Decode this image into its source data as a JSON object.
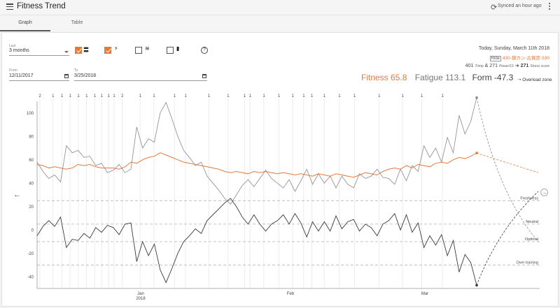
{
  "header": {
    "title": "Fitness Trend",
    "sync_status": "Synced an hour ago"
  },
  "tabs": [
    {
      "label": "Graph",
      "active": true
    },
    {
      "label": "Table",
      "active": false
    }
  ],
  "filters": {
    "last_label": "Last",
    "last_value": "3 months",
    "from_label": "From",
    "from_value": "12/11/2017",
    "to_label": "To",
    "to_value": "3/25/2018"
  },
  "toggles": [
    {
      "icon": "swim-bike-icon",
      "checked": true
    },
    {
      "icon": "power-bolt-icon",
      "checked": true
    },
    {
      "icon": "swim-icon",
      "checked": false
    },
    {
      "icon": "battery-icon",
      "checked": false
    }
  ],
  "info": {
    "date": "Today, Sunday, March 11th 2018",
    "ride_tag": "Ride",
    "ride_text": "430-鎖カン-古賀彦-530",
    "trimp_value": "401",
    "trimp_unit": "Trimp",
    "amp": "&",
    "power_value": "271",
    "power_unit": "PowerSS",
    "arrow": "➜",
    "stress_value": "271",
    "stress_unit": "Stress score"
  },
  "metrics": {
    "fitness_label": "Fitness 65.8",
    "fatigue_label": "Fatigue 113.1",
    "form_label": "Form -47.3"
  },
  "overload_label": "Overload zone",
  "colors": {
    "fitness": "#e37a3c",
    "fatigue": "#8a8a8a",
    "form": "#3a3a3a",
    "accent": "#e37a3c"
  },
  "chart_data": {
    "type": "line",
    "y_ticks": [
      "100",
      "80",
      "60",
      "40",
      "20",
      "0",
      "-20",
      "-40"
    ],
    "ylim": [
      -50,
      110
    ],
    "x_ticks": [
      {
        "label": "Jan",
        "sub": "2018"
      },
      {
        "label": "Feb",
        "sub": ""
      },
      {
        "label": "Mar",
        "sub": ""
      }
    ],
    "zones": [
      {
        "label": "Freshness",
        "value": 25
      },
      {
        "label": "Neutral",
        "value": 5
      },
      {
        "label": "Optimal",
        "value": -10
      },
      {
        "label": "Over training",
        "value": -30
      }
    ],
    "activity_markers": [
      "2",
      "1",
      "1",
      "1",
      "1",
      "1",
      "1",
      "1",
      "1",
      "1",
      "2",
      "1",
      "1",
      "1",
      "1",
      "1",
      "1",
      "1",
      "1",
      "1",
      "1",
      "1",
      "1",
      "1",
      "1",
      "1",
      "1",
      "1",
      "1",
      "1",
      "1"
    ],
    "series": [
      {
        "name": "Fitness",
        "values": [
          56,
          55,
          53,
          54,
          53,
          52,
          53,
          56,
          55,
          56,
          54,
          53,
          53,
          53,
          52,
          54,
          58,
          57,
          60,
          62,
          63,
          66,
          64,
          62,
          60,
          58,
          57,
          56,
          55,
          54,
          53,
          52,
          50,
          49,
          50,
          49,
          48,
          50,
          49,
          50,
          49,
          48,
          49,
          48,
          47,
          48,
          47,
          46,
          48,
          47,
          46,
          48,
          47,
          46,
          45,
          47,
          49,
          48,
          47,
          50,
          52,
          53,
          52,
          55,
          53,
          56,
          55,
          54,
          57,
          58,
          57,
          60,
          62,
          61,
          63,
          65.8
        ]
      },
      {
        "name": "Fatigue",
        "values": [
          58,
          50,
          44,
          47,
          41,
          72,
          66,
          68,
          62,
          63,
          55,
          57,
          49,
          51,
          56,
          49,
          52,
          88,
          70,
          78,
          75,
          100,
          109,
          95,
          80,
          68,
          62,
          55,
          58,
          46,
          40,
          34,
          27,
          22,
          30,
          38,
          43,
          37,
          44,
          51,
          44,
          40,
          36,
          43,
          33,
          42,
          52,
          39,
          48,
          40,
          46,
          36,
          46,
          39,
          36,
          48,
          44,
          46,
          52,
          45,
          44,
          39,
          52,
          42,
          55,
          50,
          72,
          62,
          70,
          58,
          79,
          66,
          98,
          82,
          93,
          113.1
        ]
      },
      {
        "name": "Form",
        "values": [
          -5,
          3,
          8,
          3,
          11,
          -15,
          -8,
          -9,
          -3,
          -7,
          2,
          -2,
          4,
          2,
          -4,
          5,
          6,
          -27,
          -10,
          -22,
          -12,
          -34,
          -45,
          -33,
          -20,
          -10,
          -5,
          1,
          -3,
          8,
          13,
          18,
          23,
          27,
          20,
          11,
          5,
          13,
          5,
          -1,
          5,
          8,
          13,
          5,
          14,
          6,
          -6,
          7,
          -1,
          7,
          -1,
          12,
          1,
          7,
          9,
          -1,
          5,
          2,
          -5,
          5,
          8,
          14,
          0,
          13,
          -2,
          6,
          -15,
          -5,
          -13,
          -4,
          -22,
          -9,
          -36,
          -21,
          -28,
          -47.3
        ]
      }
    ],
    "forecast_note": "dashed projection lines after today"
  }
}
